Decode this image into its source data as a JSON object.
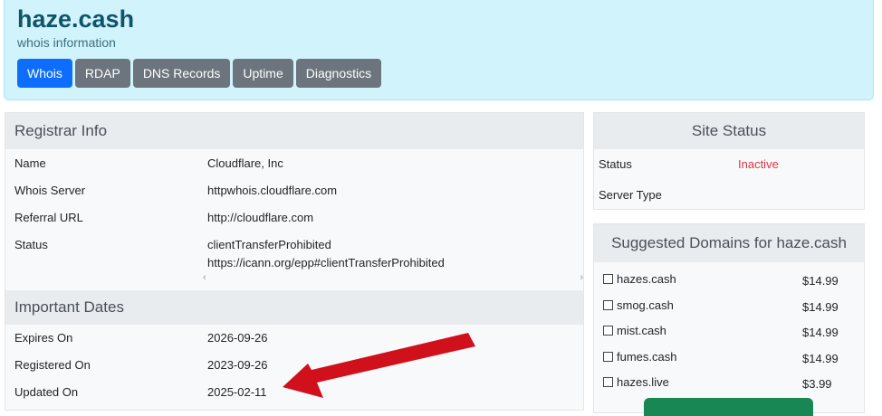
{
  "header": {
    "title": "haze.cash",
    "subtitle": "whois information",
    "tabs": [
      "Whois",
      "RDAP",
      "DNS Records",
      "Uptime",
      "Diagnostics"
    ]
  },
  "registrar": {
    "heading": "Registrar Info",
    "rows": [
      {
        "label": "Name",
        "value": "Cloudflare, Inc"
      },
      {
        "label": "Whois Server",
        "value": "httpwhois.cloudflare.com"
      },
      {
        "label": "Referral URL",
        "value": "http://cloudflare.com"
      },
      {
        "label": "Status",
        "value": "clientTransferProhibited",
        "value2": "https://icann.org/epp#clientTransferProhibited"
      }
    ],
    "scroll_left": "‹",
    "scroll_right": "›"
  },
  "dates": {
    "heading": "Important Dates",
    "rows": [
      {
        "label": "Expires On",
        "value": "2026-09-26"
      },
      {
        "label": "Registered On",
        "value": "2023-09-26"
      },
      {
        "label": "Updated On",
        "value": "2025-02-11"
      }
    ]
  },
  "site_status": {
    "heading": "Site Status",
    "status_label": "Status",
    "status_value": "Inactive",
    "server_type_label": "Server Type",
    "status_color": "#dc3545"
  },
  "suggested": {
    "heading": "Suggested Domains for haze.cash",
    "items": [
      {
        "domain": "hazes.cash",
        "price": "$14.99"
      },
      {
        "domain": "smog.cash",
        "price": "$14.99"
      },
      {
        "domain": "mist.cash",
        "price": "$14.99"
      },
      {
        "domain": "fumes.cash",
        "price": "$14.99"
      },
      {
        "domain": "hazes.live",
        "price": "$3.99"
      }
    ]
  },
  "colors": {
    "accent": "#0d6efd",
    "tab": "#6c757d",
    "header_bg": "#d1f3fb",
    "annotation_arrow": "#d0111b",
    "buy_button": "#198754"
  }
}
